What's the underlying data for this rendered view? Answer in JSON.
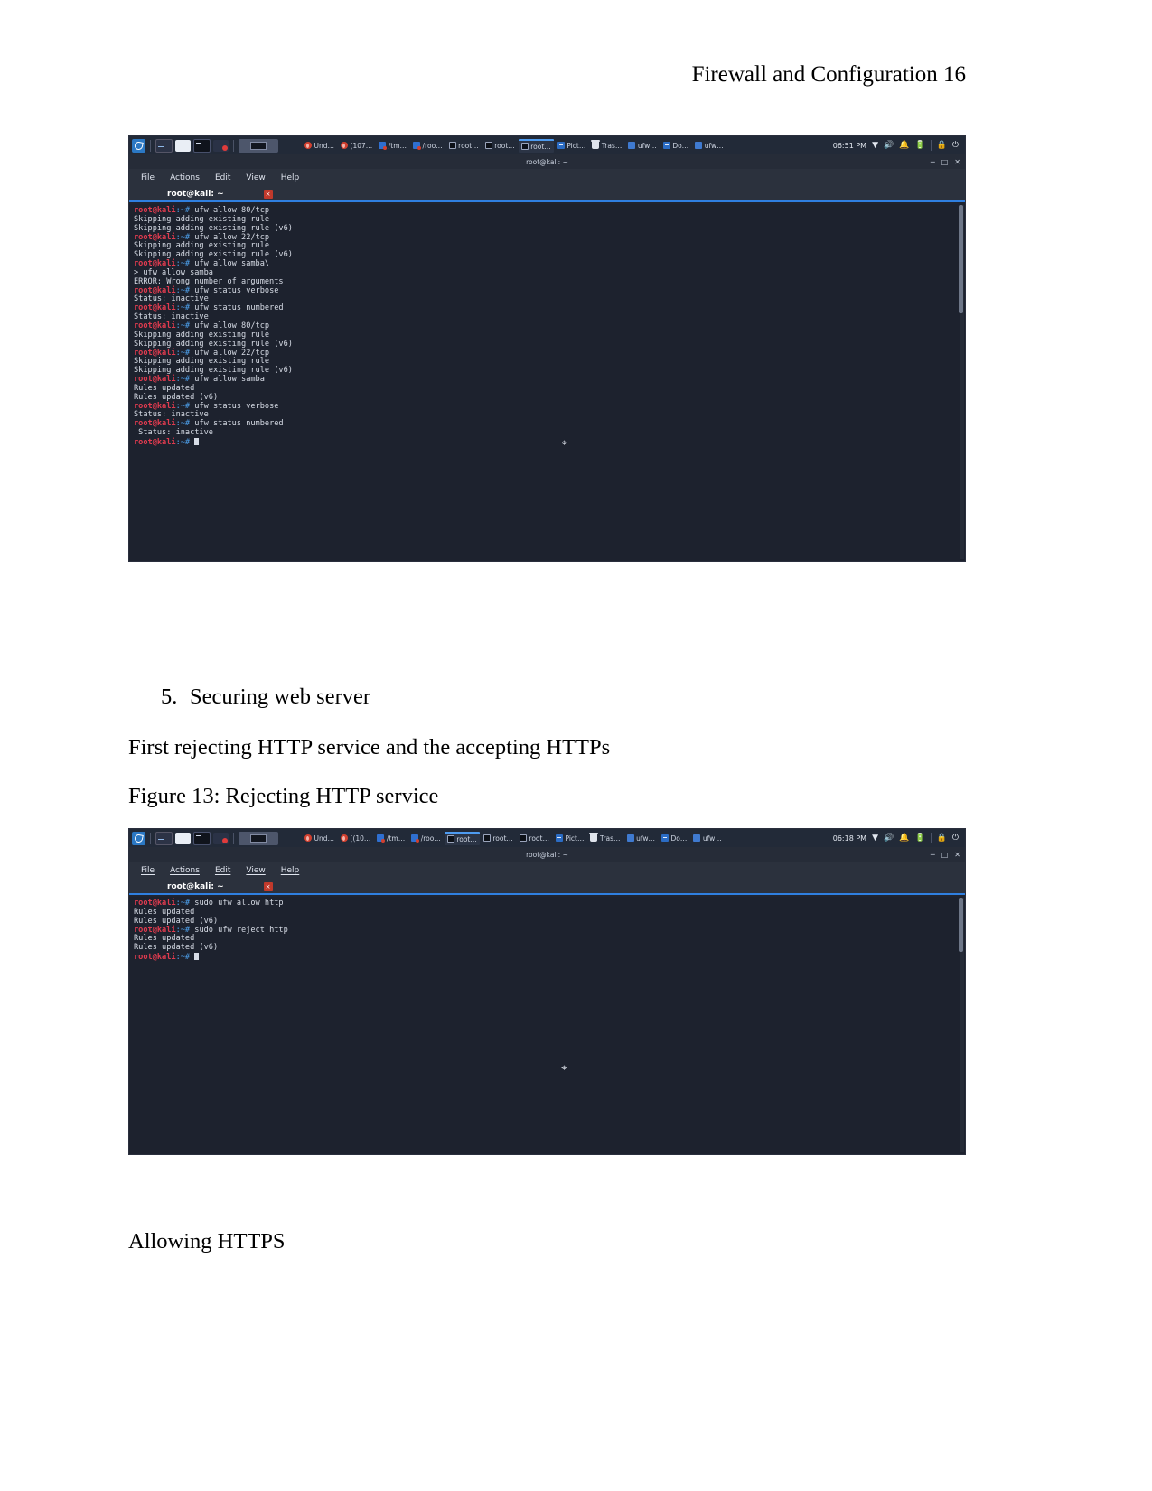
{
  "document": {
    "header": "Firewall and Configuration 16",
    "list_item_number": "5.",
    "list_item_text": "Securing web server",
    "paragraph_1": "First rejecting HTTP service and the accepting HTTPs",
    "figure_caption": "Figure 13: Rejecting HTTP service",
    "paragraph_2": "Allowing HTTPS"
  },
  "screenshot_1": {
    "taskbar": {
      "logo": "kali-dragon-logo",
      "launchers": [
        "terminal-launcher",
        "files-launcher",
        "terminal-black-launcher",
        "burp-launcher"
      ],
      "active_window_button": "terminal-window-button",
      "items": [
        {
          "icon": "burp-icon",
          "label": "Und…"
        },
        {
          "icon": "burp-icon",
          "label": "(107…"
        },
        {
          "icon": "file-manager-icon",
          "label": "/tm…"
        },
        {
          "icon": "file-manager-icon",
          "label": "/roo…"
        },
        {
          "icon": "terminal-icon",
          "label": "root…"
        },
        {
          "icon": "terminal-icon",
          "label": "root…"
        },
        {
          "icon": "terminal-icon",
          "label": "root…"
        },
        {
          "icon": "terminal-blue-icon",
          "label": "Pict…"
        },
        {
          "icon": "trash-icon",
          "label": "Tras…"
        },
        {
          "icon": "document-icon",
          "label": "ufw…"
        },
        {
          "icon": "terminal-blue-icon",
          "label": "Do…"
        },
        {
          "icon": "document-icon",
          "label": "ufw…"
        }
      ],
      "clock": "06:51 PM",
      "tray": [
        "chevron-down-icon",
        "volume-icon",
        "bell-icon",
        "battery-icon",
        "lock-icon",
        "power-icon"
      ]
    },
    "window": {
      "title": "root@kali: ~",
      "controls": [
        "minimize-icon",
        "maximize-icon",
        "close-icon"
      ],
      "menus": [
        "File",
        "Actions",
        "Edit",
        "View",
        "Help"
      ],
      "tab_label": "root@kali: ~",
      "tab_close": "×"
    },
    "terminal": {
      "prompt_user": "root@kali",
      "prompt_tail": ":~#",
      "lines": [
        {
          "type": "cmd",
          "text": " ufw allow 80/tcp"
        },
        {
          "type": "out",
          "text": "Skipping adding existing rule"
        },
        {
          "type": "out",
          "text": "Skipping adding existing rule (v6)"
        },
        {
          "type": "cmd",
          "text": " ufw allow 22/tcp"
        },
        {
          "type": "out",
          "text": "Skipping adding existing rule"
        },
        {
          "type": "out",
          "text": "Skipping adding existing rule (v6)"
        },
        {
          "type": "cmd",
          "text": " ufw allow samba\\"
        },
        {
          "type": "out",
          "text": "> ufw allow samba"
        },
        {
          "type": "out",
          "text": "ERROR: Wrong number of arguments"
        },
        {
          "type": "cmd",
          "text": " ufw status verbose"
        },
        {
          "type": "out",
          "text": "Status: inactive"
        },
        {
          "type": "cmd",
          "text": " ufw status numbered"
        },
        {
          "type": "out",
          "text": "Status: inactive"
        },
        {
          "type": "cmd",
          "text": " ufw allow 80/tcp"
        },
        {
          "type": "out",
          "text": "Skipping adding existing rule"
        },
        {
          "type": "out",
          "text": "Skipping adding existing rule (v6)"
        },
        {
          "type": "cmd",
          "text": " ufw allow 22/tcp"
        },
        {
          "type": "out",
          "text": "Skipping adding existing rule"
        },
        {
          "type": "out",
          "text": "Skipping adding existing rule (v6)"
        },
        {
          "type": "cmd",
          "text": " ufw allow samba"
        },
        {
          "type": "out",
          "text": "Rules updated"
        },
        {
          "type": "out",
          "text": "Rules updated (v6)"
        },
        {
          "type": "cmd",
          "text": " ufw status verbose"
        },
        {
          "type": "out",
          "text": "Status: inactive"
        },
        {
          "type": "cmd",
          "text": " ufw status numbered"
        },
        {
          "type": "out",
          "text": "'Status: inactive"
        },
        {
          "type": "prompt",
          "text": " "
        }
      ]
    }
  },
  "screenshot_2": {
    "taskbar": {
      "logo": "kali-dragon-logo",
      "launchers": [
        "terminal-launcher",
        "files-launcher",
        "terminal-black-launcher",
        "burp-launcher"
      ],
      "active_window_button": "terminal-window-button",
      "items": [
        {
          "icon": "burp-icon",
          "label": "Und…"
        },
        {
          "icon": "burp-icon",
          "label": "[(10…"
        },
        {
          "icon": "file-manager-icon",
          "label": "/tm…"
        },
        {
          "icon": "file-manager-icon",
          "label": "/roo…"
        },
        {
          "icon": "terminal-icon",
          "label": "root…"
        },
        {
          "icon": "terminal-icon",
          "label": "root…"
        },
        {
          "icon": "terminal-icon",
          "label": "root…"
        },
        {
          "icon": "terminal-blue-icon",
          "label": "Pict…"
        },
        {
          "icon": "trash-icon",
          "label": "Tras…"
        },
        {
          "icon": "document-icon",
          "label": "ufw…"
        },
        {
          "icon": "terminal-blue-icon",
          "label": "Do…"
        },
        {
          "icon": "document-icon",
          "label": "ufw…"
        }
      ],
      "clock": "06:18 PM",
      "tray": [
        "chevron-down-icon",
        "volume-icon",
        "bell-icon",
        "battery-icon",
        "lock-icon",
        "power-icon"
      ]
    },
    "window": {
      "title": "root@kali: ~",
      "controls": [
        "minimize-icon",
        "maximize-icon",
        "close-icon"
      ],
      "menus": [
        "File",
        "Actions",
        "Edit",
        "View",
        "Help"
      ],
      "tab_label": "root@kali: ~",
      "tab_close": "×"
    },
    "terminal": {
      "prompt_user": "root@kali",
      "prompt_tail": ":~#",
      "lines": [
        {
          "type": "cmd",
          "text": " sudo ufw allow http"
        },
        {
          "type": "out",
          "text": "Rules updated"
        },
        {
          "type": "out",
          "text": "Rules updated (v6)"
        },
        {
          "type": "cmd",
          "text": " sudo ufw reject http"
        },
        {
          "type": "out",
          "text": "Rules updated"
        },
        {
          "type": "out",
          "text": "Rules updated (v6)"
        },
        {
          "type": "prompt",
          "text": " "
        }
      ]
    }
  },
  "colors": {
    "terminal_bg": "#1d222e",
    "taskbar_bg": "#222a38",
    "prompt_red": "#e03b4f",
    "prompt_blue": "#4ea3f0",
    "accent_blue": "#2f7fe0",
    "page_bg": "#ffffff"
  }
}
